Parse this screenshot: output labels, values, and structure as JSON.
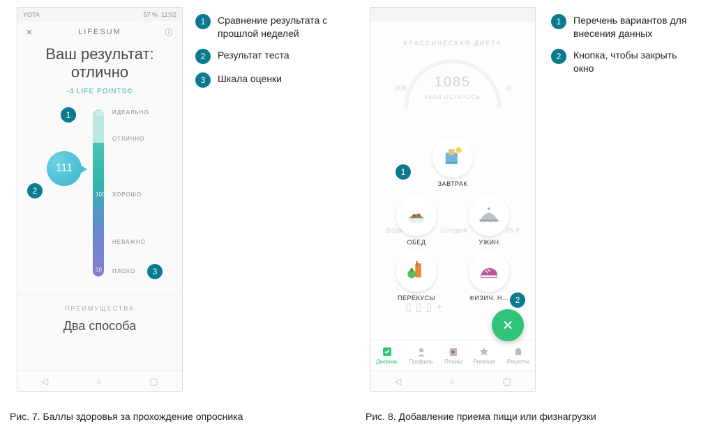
{
  "figure7": {
    "status": {
      "carrier": "YOTA",
      "battery": "57 %",
      "time": "11:02"
    },
    "app_name": "LIFESUM",
    "result_line1": "Ваш результат:",
    "result_line2": "отлично",
    "life_points": "-4 LIFE POINTS©",
    "score": "111",
    "scale_labels": {
      "ideal": "ИДЕАЛЬНО",
      "great": "ОТЛИЧНО",
      "good": "ХОРОШО",
      "meh": "НЕВАЖНО",
      "bad": "ПЛОХО"
    },
    "scale_nums": {
      "top": "150",
      "mid": "100",
      "low": "50"
    },
    "advantages": "ПРЕИМУЩЕСТВА",
    "two_ways": "Два способа",
    "legend": {
      "l1": "Сравнение результата с прошлой неделей",
      "l2": "Результат теста",
      "l3": "Шкала оценки"
    },
    "callouts": {
      "c1": "1",
      "c2": "2",
      "c3": "3"
    },
    "caption": "Рис. 7. Баллы здоровья за прохождение опросника"
  },
  "figure8": {
    "dim_title": "КЛАССИЧЕСКАЯ ДИЕТА",
    "ring_center": "1085",
    "ring_sub": "ККАЛ ОСТАЛОСЬ",
    "ring_left": "206",
    "ring_right": "-0",
    "meals": {
      "breakfast": "ЗАВТРАК",
      "lunch": "ОБЕД",
      "dinner": "УЖИН",
      "snack": "ПЕРЕКУСЫ",
      "exercise": "ФИЗИЧ. Н..."
    },
    "today": "Сегодня",
    "water_label": "Вода",
    "water_val": "75 Л",
    "nav": {
      "diary": "Дневник",
      "profile": "Профиль",
      "plans": "Планы",
      "premium": "Premium",
      "recipes": "Рецепты"
    },
    "legend": {
      "l1": "Перечень вариантов для внесения данных",
      "l2": "Кнопка, чтобы закрыть окно"
    },
    "callouts": {
      "c1": "1",
      "c2": "2"
    },
    "caption": "Рис. 8. Добавление приема пищи или физнагрузки"
  }
}
